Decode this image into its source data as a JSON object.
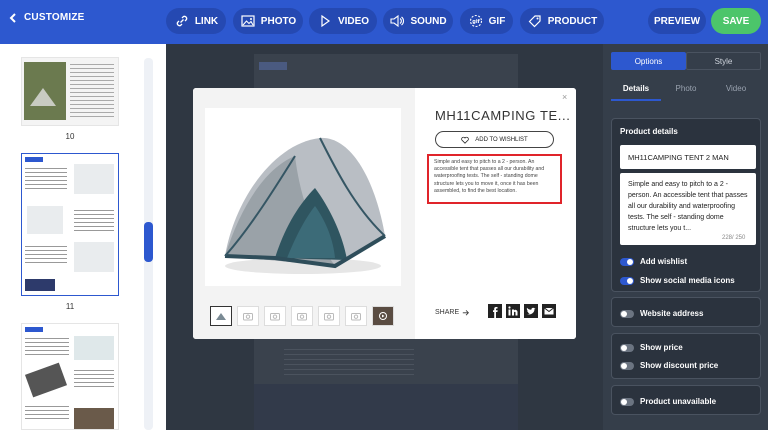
{
  "topbar": {
    "back_label": "CUSTOMIZE",
    "tools": [
      {
        "label": "LINK",
        "icon": "link-icon"
      },
      {
        "label": "PHOTO",
        "icon": "photo-icon"
      },
      {
        "label": "VIDEO",
        "icon": "video-icon"
      },
      {
        "label": "SOUND",
        "icon": "sound-icon"
      },
      {
        "label": "GIF",
        "icon": "gif-icon"
      },
      {
        "label": "PRODUCT",
        "icon": "tag-icon"
      }
    ],
    "preview_label": "PREVIEW",
    "save_label": "SAVE",
    "colors": {
      "bar": "#2d58cf",
      "save": "#4cc56a"
    }
  },
  "pages": [
    {
      "number": "10"
    },
    {
      "number": "11",
      "selected": true
    },
    {
      "number": ""
    }
  ],
  "modal": {
    "title": "MH11CAMPING TE...",
    "wishlist_label": "ADD TO WISHLIST",
    "description": "Simple and easy to pitch to a 2 - person. An accessible tent that passes all our durability and waterproofing tests. The self - standing dome structure lets you to move it, once it has been assembled, to find the best location.",
    "share_label": "SHARE",
    "close_label": "×",
    "social": [
      "facebook-icon",
      "linkedin-icon",
      "twitter-icon",
      "email-icon"
    ]
  },
  "panel": {
    "tabs": {
      "options": "Options",
      "style": "Style"
    },
    "subtabs": {
      "details": "Details",
      "photo": "Photo",
      "video": "Video"
    },
    "product_details_heading": "Product details",
    "name_value": "MH11CAMPING TENT 2 MAN",
    "description_value": "Simple and easy to pitch to a 2 - person. An accessible tent that passes all our durability and waterproofing tests. The self - standing dome structure lets you t...",
    "char_count": "228/ 250",
    "add_wishlist": "Add wishlist",
    "show_social": "Show social media icons",
    "website_address": "Website address",
    "show_price": "Show price",
    "show_discount": "Show discount price",
    "product_unavailable": "Product unavailable"
  }
}
